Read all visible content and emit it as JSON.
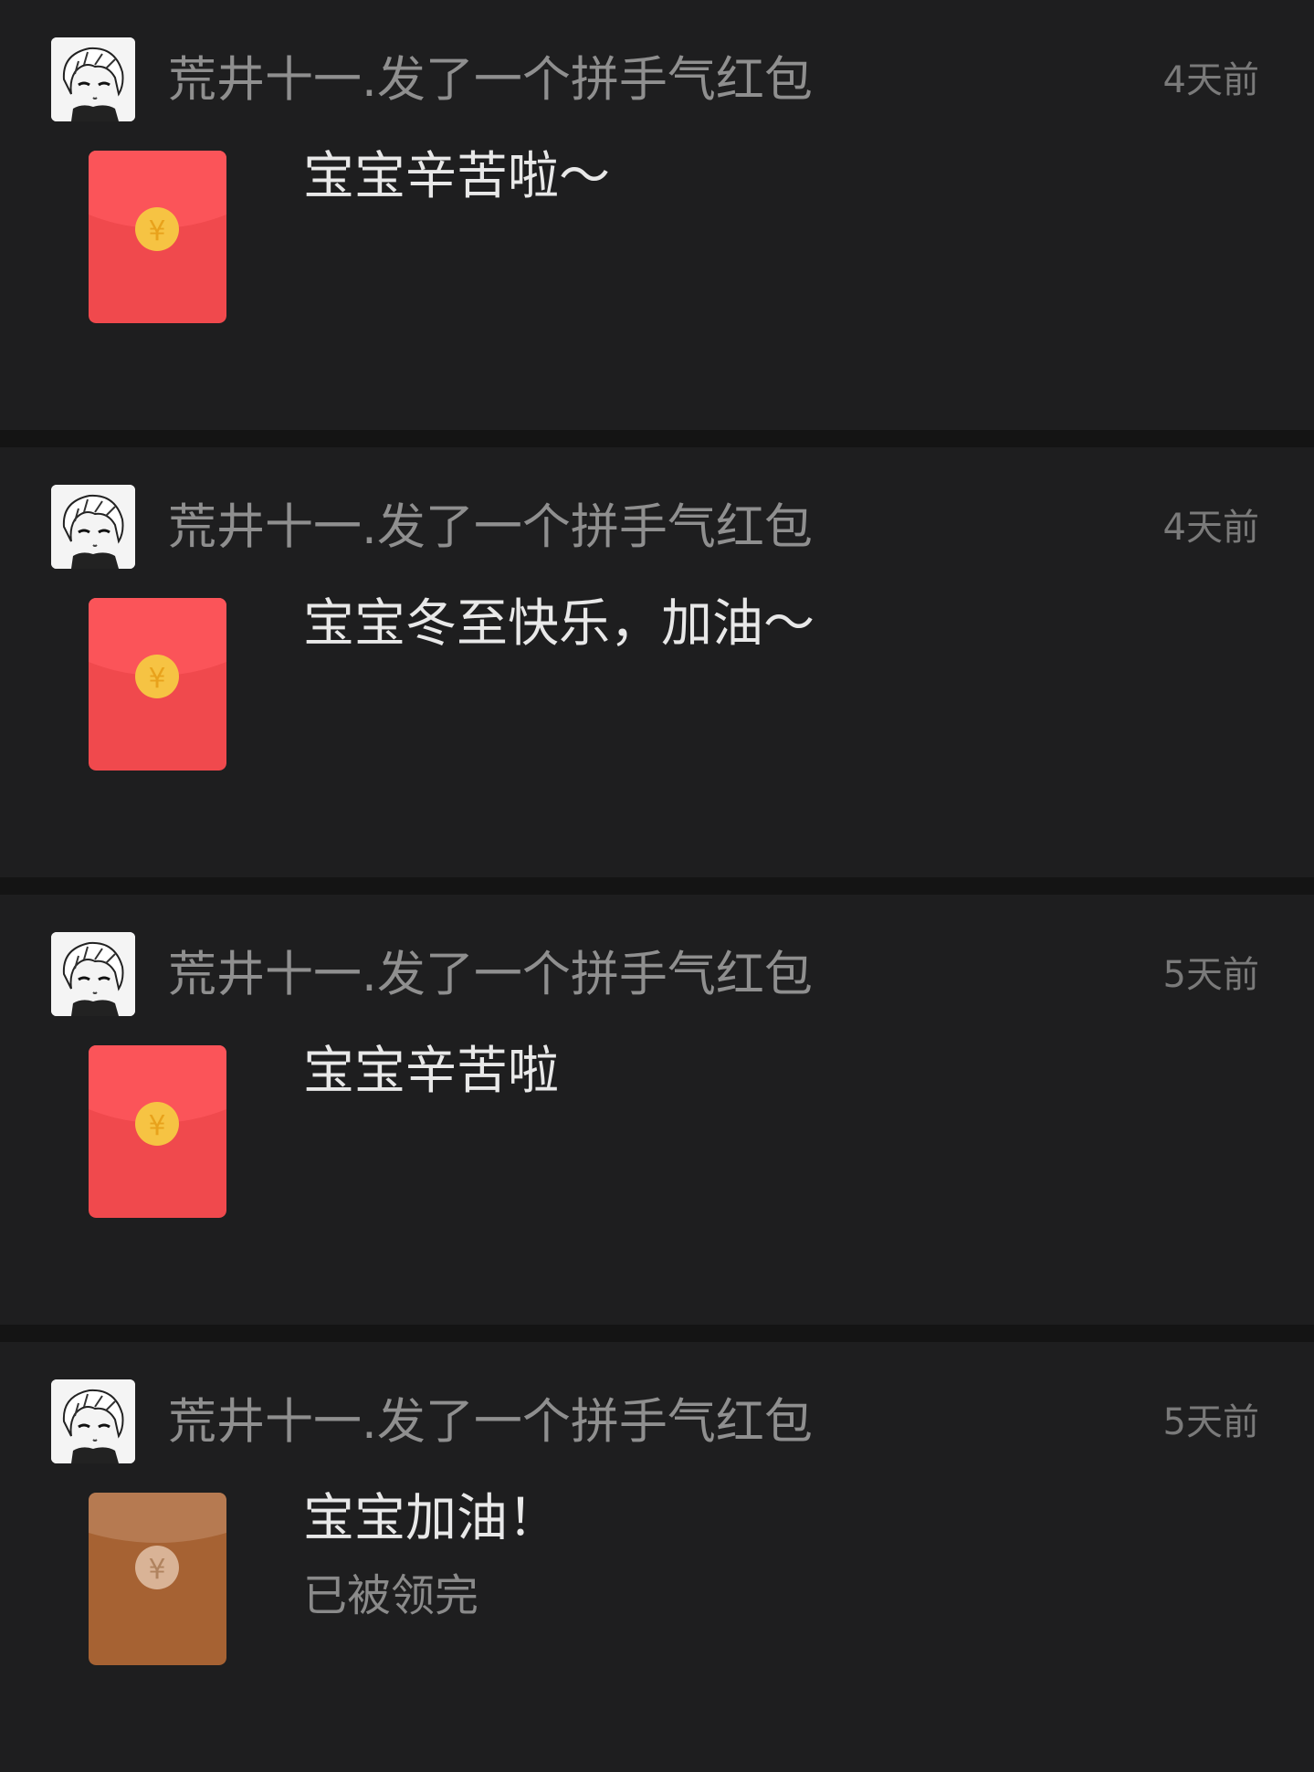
{
  "colors": {
    "page_background": "#141414",
    "card_background": "#1e1e1f",
    "red_envelope": "#f0494d",
    "red_envelope_flap": "#fb5459",
    "coin": "#f6c343",
    "opened_envelope": "#a66233",
    "opened_envelope_flap": "#b67a51",
    "opened_coin": "#d9b396"
  },
  "items": [
    {
      "sender": "荒井十一.",
      "action": "发了一个拼手气红包",
      "time": "4天前",
      "message": "宝宝辛苦啦～",
      "status": "",
      "opened": false,
      "avatar_icon": "anime-avatar-icon",
      "envelope_icon": "red-envelope-icon",
      "coin_symbol": "¥"
    },
    {
      "sender": "荒井十一.",
      "action": "发了一个拼手气红包",
      "time": "4天前",
      "message": "宝宝冬至快乐，加油～",
      "status": "",
      "opened": false,
      "avatar_icon": "anime-avatar-icon",
      "envelope_icon": "red-envelope-icon",
      "coin_symbol": "¥"
    },
    {
      "sender": "荒井十一.",
      "action": "发了一个拼手气红包",
      "time": "5天前",
      "message": "宝宝辛苦啦",
      "status": "",
      "opened": false,
      "avatar_icon": "anime-avatar-icon",
      "envelope_icon": "red-envelope-icon",
      "coin_symbol": "¥"
    },
    {
      "sender": "荒井十一.",
      "action": "发了一个拼手气红包",
      "time": "5天前",
      "message": "宝宝加油！",
      "status": "已被领完",
      "opened": true,
      "avatar_icon": "anime-avatar-icon",
      "envelope_icon": "opened-red-envelope-icon",
      "coin_symbol": "¥"
    }
  ]
}
